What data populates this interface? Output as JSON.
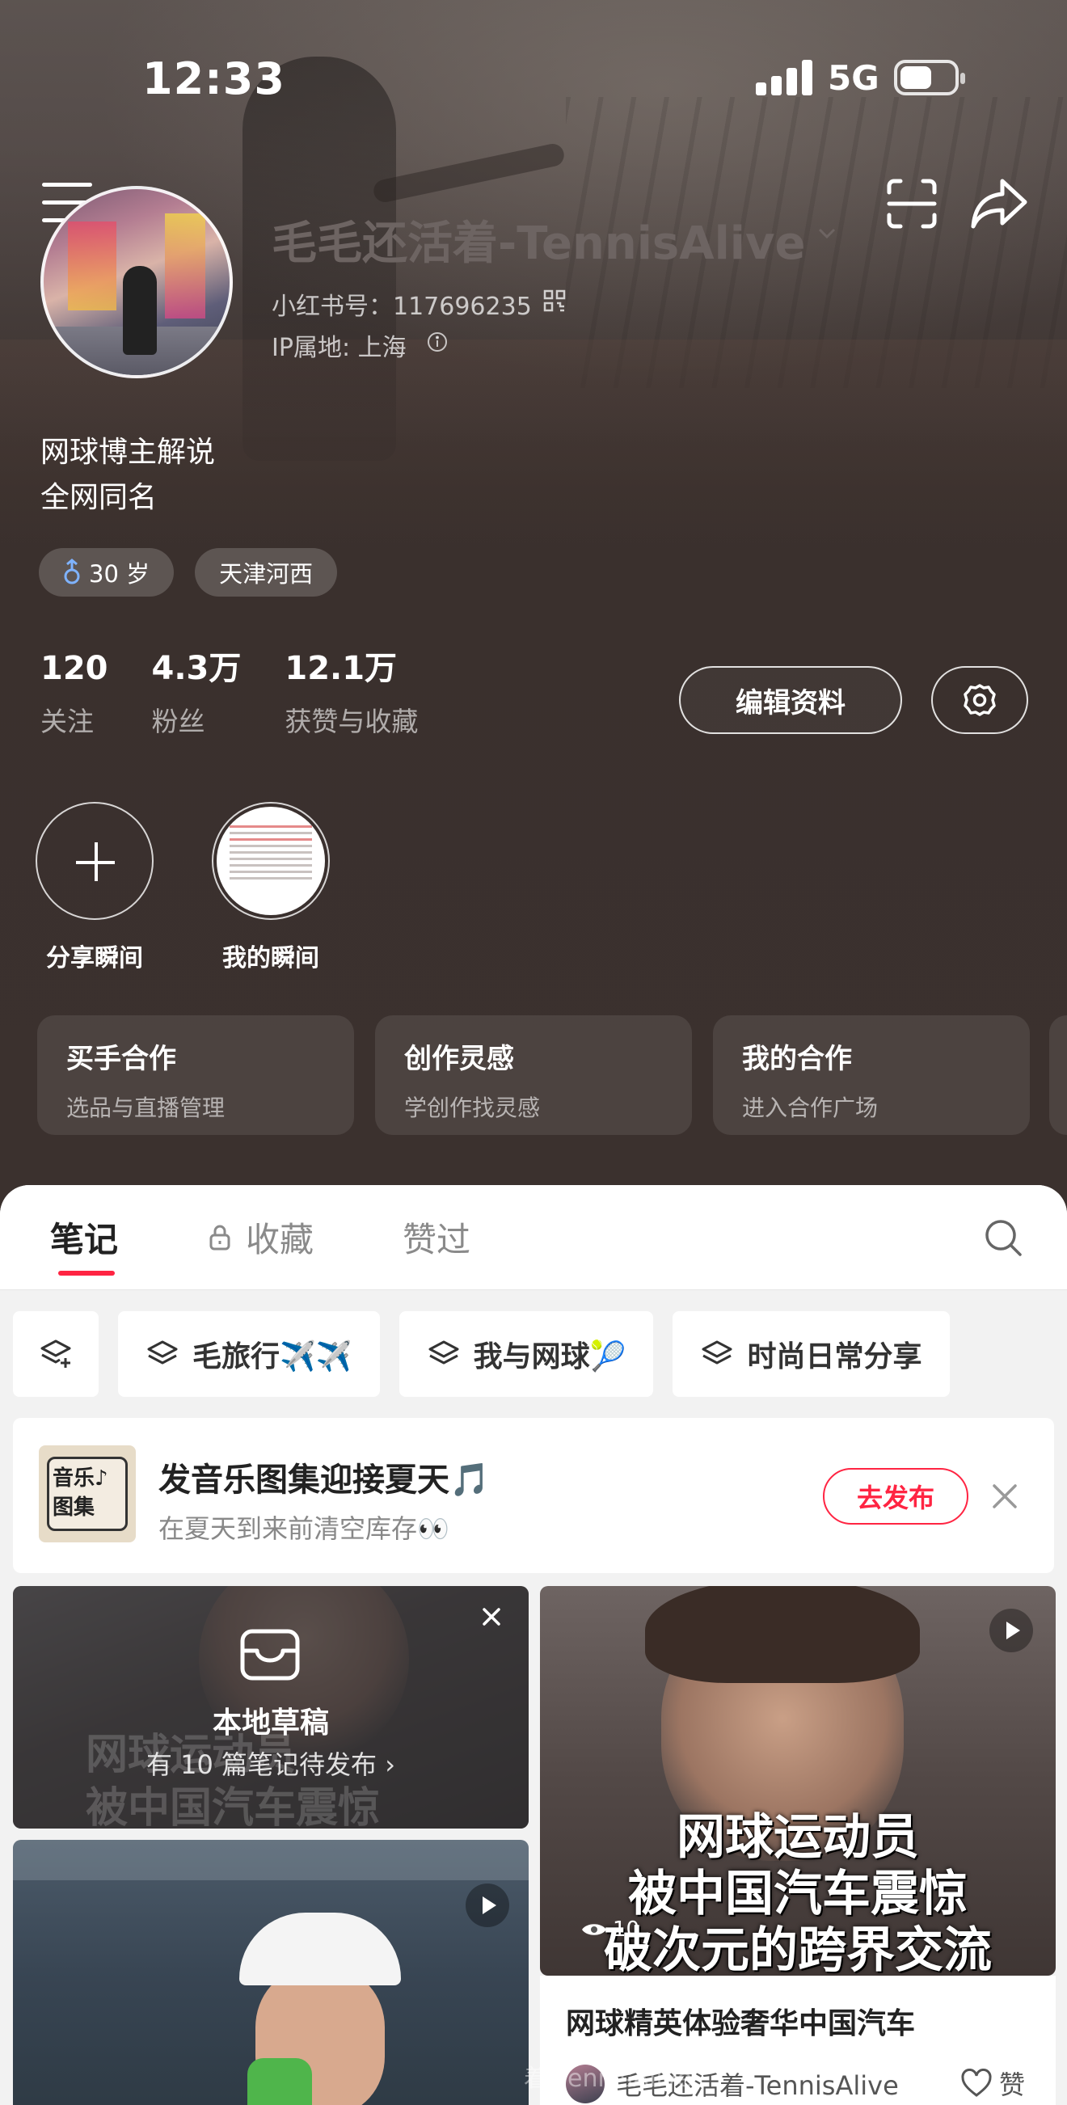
{
  "status_bar": {
    "time": "12:33",
    "network": "5G"
  },
  "profile": {
    "username": "毛毛还活着-TennisAlive",
    "red_id": "小红书号：117696235",
    "ip_location": "IP属地: 上海",
    "bio_line1": "网球博主解说",
    "bio_line2": "全网同名",
    "tags": {
      "age": "30 岁",
      "location": "天津河西"
    },
    "stats": [
      {
        "num": "120",
        "label": "关注"
      },
      {
        "num": "4.3万",
        "label": "粉丝"
      },
      {
        "num": "12.1万",
        "label": "获赞与收藏"
      }
    ],
    "edit_button": "编辑资料"
  },
  "moments": {
    "share": "分享瞬间",
    "mine": "我的瞬间"
  },
  "feature_cards": [
    {
      "title": "买手合作",
      "sub": "选品与直播管理"
    },
    {
      "title": "创作灵感",
      "sub": "学创作找灵感"
    },
    {
      "title": "我的合作",
      "sub": "进入合作广场"
    }
  ],
  "tabs": {
    "notes": "笔记",
    "collect": "收藏",
    "liked": "赞过"
  },
  "collections": [
    "毛旅行✈️✈️",
    "我与网球🎾",
    "时尚日常分享"
  ],
  "promo": {
    "thumb_text": "音乐♪图集",
    "title": "发音乐图集迎接夏天🎵",
    "subtitle": "在夏天到来前清空库存👀",
    "button": "去发布"
  },
  "draft": {
    "title": "本地草稿",
    "subtitle": "有 10 篇笔记待发布 ›",
    "ghost_text": "网球运动员\n被中国汽车震惊"
  },
  "note1": {
    "overlay_line1": "网球运动员",
    "overlay_line2": "被中国汽车震惊",
    "overlay_line3": "破次元的跨界交流",
    "views": "10",
    "title": "网球精英体验奢华中国汽车",
    "author": "毛毛还活着-TennisAlive",
    "like_label": "赞"
  },
  "watermark": "着-TennisAlive",
  "colors": {
    "accent": "#ff2442",
    "header_bg": "#3b312e"
  }
}
